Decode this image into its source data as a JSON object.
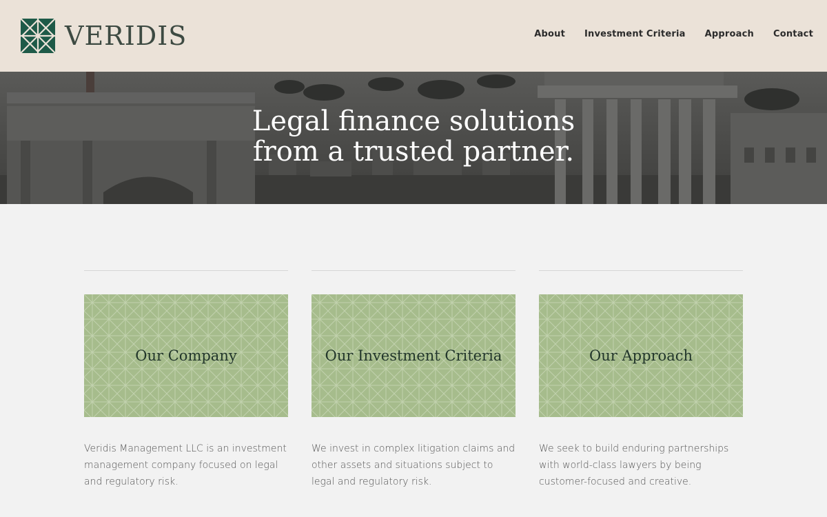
{
  "brand": {
    "name": "VERIDIS",
    "mark_color": "#1e5a48"
  },
  "nav": {
    "items": [
      {
        "label": "About"
      },
      {
        "label": "Investment Criteria"
      },
      {
        "label": "Approach"
      },
      {
        "label": "Contact"
      }
    ]
  },
  "hero": {
    "title_line1": "Legal finance solutions",
    "title_line2": "from a trusted partner."
  },
  "cards": [
    {
      "title": "Our Company",
      "text": "Veridis Management LLC is an investment management company focused on legal and regulatory risk."
    },
    {
      "title": "Our Investment Criteria",
      "text": "We invest in complex litigation claims and other assets and situations subject to legal and regulatory risk."
    },
    {
      "title": "Our Approach",
      "text": "We seek to build enduring partnerships with world-class lawyers by being customer-focused and creative."
    }
  ],
  "colors": {
    "header_bg": "#ebe2d8",
    "tile_bg": "#a6bc8c",
    "page_bg": "#f2f2f2"
  }
}
